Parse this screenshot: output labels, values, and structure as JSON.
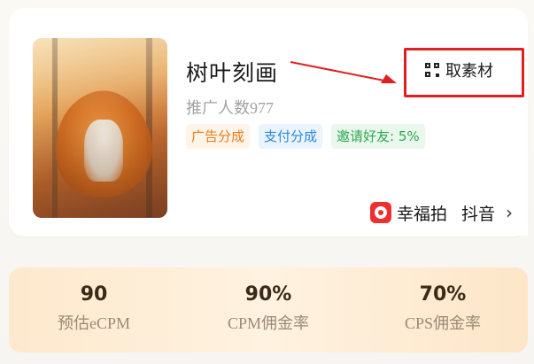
{
  "material": {
    "title": "树叶刻画",
    "promoters": "推广人数977",
    "tags": [
      "广告分成",
      "支付分成",
      "邀请好友: 5%"
    ],
    "get_button": "取素材"
  },
  "platform": {
    "app_name": "幸福拍",
    "channel": "抖音",
    "chevron": "›"
  },
  "stats": [
    {
      "value": "90",
      "label": "预估eCPM"
    },
    {
      "value": "90%",
      "label": "CPM佣金率"
    },
    {
      "value": "70%",
      "label": "CPS佣金率"
    }
  ],
  "colors": {
    "tag_orange": "#f07a1b",
    "tag_blue": "#2f86e0",
    "tag_green": "#2fa84f",
    "highlight_red": "#e02020",
    "app_icon_red": "#ee2f2f"
  },
  "icons": {
    "get_button_icon": "qr-code-icon",
    "app_icon": "xingfupai-app-icon"
  }
}
